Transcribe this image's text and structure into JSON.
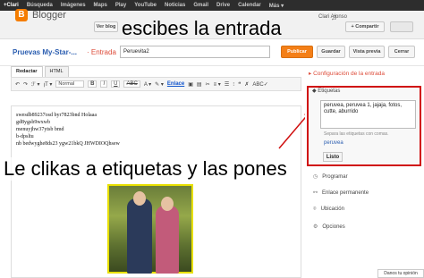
{
  "gbar": {
    "items": [
      "+Clari",
      "Búsqueda",
      "Imágenes",
      "Maps",
      "Play",
      "YouTube",
      "Noticias",
      "Gmail",
      "Drive",
      "Calendar",
      "Más ▾"
    ]
  },
  "header": {
    "brand": "Blogger",
    "ver_blog": "Ver blog",
    "user": "Clari Alonso",
    "compartir": "+ Compartir"
  },
  "captions": {
    "top": "escibes la entrada",
    "main": "Le clikas a etiquetas y las pones"
  },
  "post": {
    "blog_name": "Pruevas My-Star-...",
    "entrada": "· Entrada",
    "title_value": "Peruevita2",
    "publish": "Publicar",
    "save": "Guardar",
    "preview": "Vista previa",
    "close": "Cerrar"
  },
  "tabs": {
    "redactar": "Redactar",
    "html": "HTML"
  },
  "toolbar": {
    "font": "Normal",
    "enlace": "Enlace"
  },
  "editor": {
    "lines": [
      "swesdb89237osd byr7823bnd Holaaa",
      "gd8ygsb9wxwb",
      "menuyjhw37ytsb bmd",
      "b-dpsltu",
      "nb bedwyghe8ds23 ygw21bkQ JHWDIOQhsew"
    ]
  },
  "sidebar": {
    "title": "Configuración de la entrada",
    "etiquetas": "Etiquetas",
    "tags_value": "peruvea, peruvea 1, jajaja, fotos, cutte, aburrido",
    "separa": "Separa las etiquetas con comas.",
    "suggestion": "peruvea",
    "listo": "Listo",
    "programar": "Programar",
    "enlace_permanente": "Enlace permanente",
    "ubicacion": "Ubicación",
    "opciones": "Opciones"
  },
  "footer": {
    "hint": "Danos tu opinión"
  },
  "colors": {
    "accent": "#f47f17",
    "highlight_box": "#d01010",
    "link": "#2a5db0"
  }
}
